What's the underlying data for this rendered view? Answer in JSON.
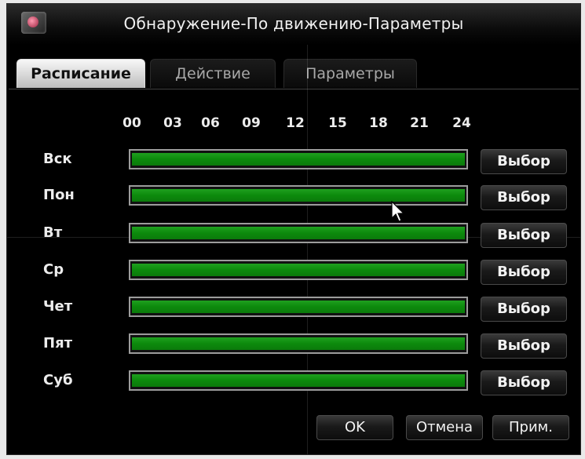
{
  "window": {
    "title": "Обнаружение-По движению-Параметры"
  },
  "icons": {
    "title": "app-logo-icon",
    "cursor": "mouse-pointer-icon"
  },
  "tabs": [
    {
      "label": "Расписание",
      "active": true
    },
    {
      "label": "Действие",
      "active": false
    },
    {
      "label": "Параметры",
      "active": false
    }
  ],
  "hours": [
    "00",
    "03",
    "06",
    "09",
    "12",
    "15",
    "18",
    "21",
    "24"
  ],
  "schedule": [
    {
      "day": "Вск",
      "button": "Выбор",
      "coverage": 1.0
    },
    {
      "day": "Пон",
      "button": "Выбор",
      "coverage": 1.0
    },
    {
      "day": "Вт",
      "button": "Выбор",
      "coverage": 1.0
    },
    {
      "day": "Ср",
      "button": "Выбор",
      "coverage": 1.0
    },
    {
      "day": "Чет",
      "button": "Выбор",
      "coverage": 1.0
    },
    {
      "day": "Пят",
      "button": "Выбор",
      "coverage": 1.0
    },
    {
      "day": "Суб",
      "button": "Выбор",
      "coverage": 1.0
    }
  ],
  "footer": {
    "ok": "OK",
    "cancel": "Отмена",
    "apply": "Прим."
  },
  "colors": {
    "schedule_fill": "#0c8a0c",
    "background": "#000000",
    "active_tab": "#e0e0e0"
  }
}
